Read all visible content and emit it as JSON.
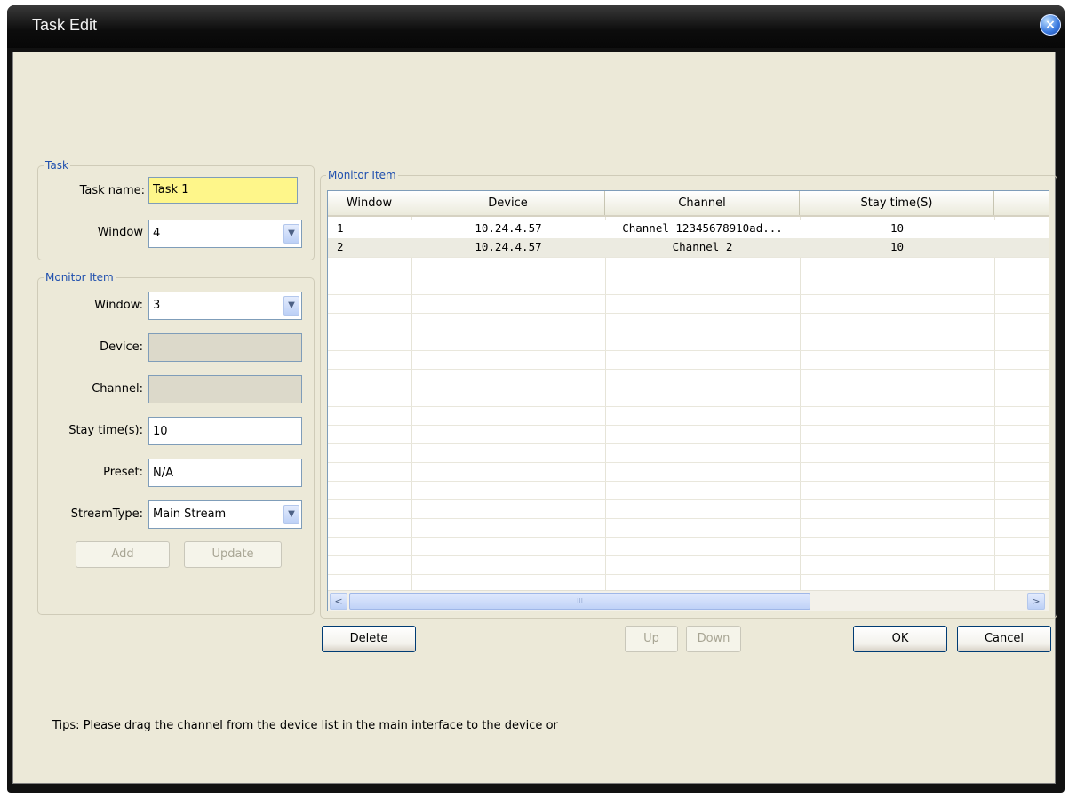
{
  "window": {
    "title": "Task Edit",
    "close_icon": "×"
  },
  "task_group": {
    "title": "Task",
    "task_name_label": "Task name:",
    "task_name_value": "Task 1",
    "window_label": "Window",
    "window_value": "4"
  },
  "monitor_form": {
    "title": "Monitor Item",
    "window_label": "Window:",
    "window_value": "3",
    "device_label": "Device:",
    "channel_label": "Channel:",
    "stay_label": "Stay time(s):",
    "stay_value": "10",
    "preset_label": "Preset:",
    "preset_value": "N/A",
    "stream_label": "StreamType:",
    "stream_value": "Main Stream",
    "add_label": "Add",
    "update_label": "Update"
  },
  "monitor_list": {
    "title": "Monitor Item",
    "columns": [
      "Window",
      "Device",
      "Channel",
      "Stay time(S)"
    ],
    "rows": [
      {
        "window": "1",
        "device": "10.24.4.57",
        "channel": "Channel 12345678910ad...",
        "stay": "10"
      },
      {
        "window": "2",
        "device": "10.24.4.57",
        "channel": "Channel 2",
        "stay": "10"
      }
    ],
    "scroll_left_icon": "<",
    "scroll_right_icon": ">",
    "scroll_grip": "III"
  },
  "buttons": {
    "delete": "Delete",
    "up": "Up",
    "down": "Down",
    "ok": "OK",
    "cancel": "Cancel"
  },
  "tips": "Tips: Please drag the channel from the device list in the main interface to the device or",
  "colors": {
    "dialog_bg": "#ece9d8",
    "group_title": "#1f4fae",
    "highlight_field": "#fef68a",
    "selection": "#316ac5",
    "alt_row": "#ecebe1"
  }
}
